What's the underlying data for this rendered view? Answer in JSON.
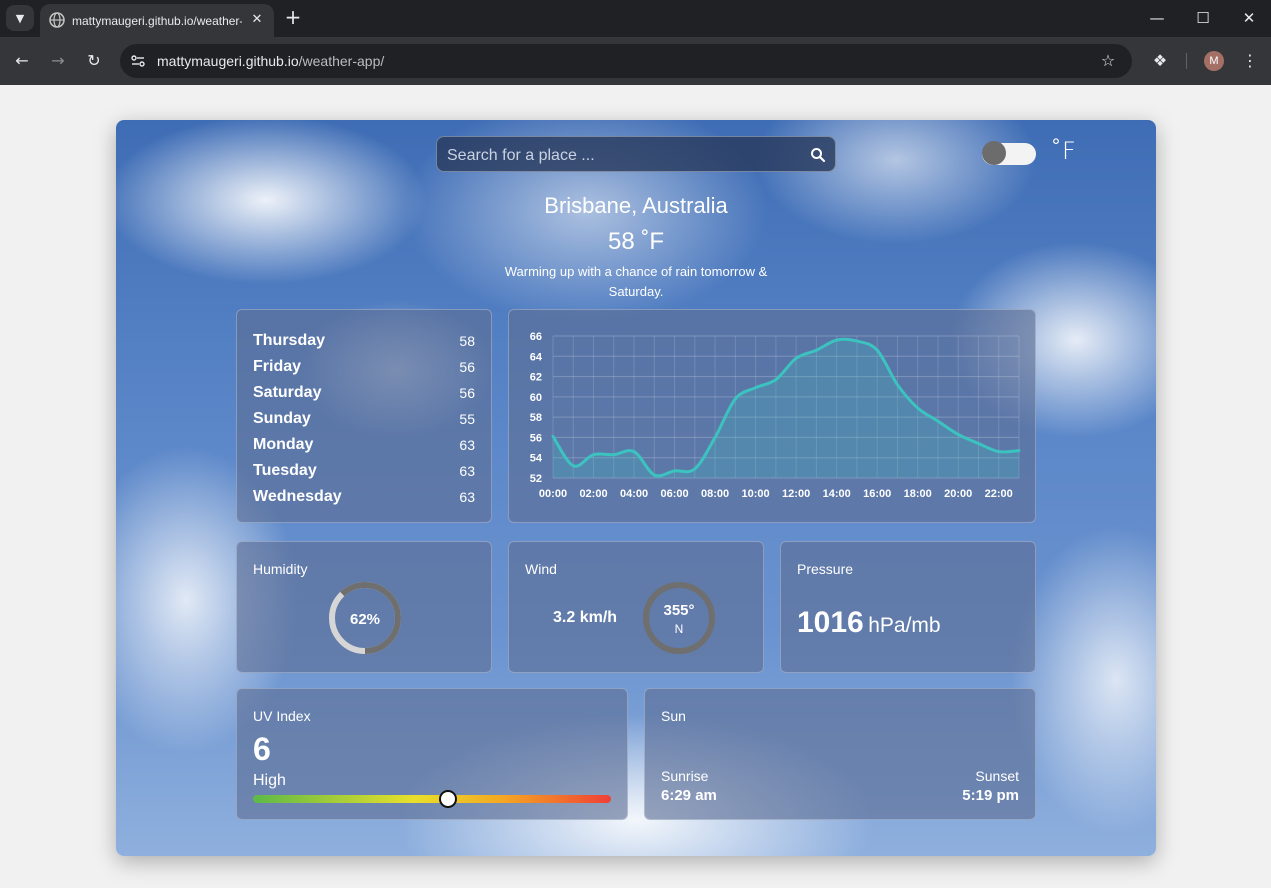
{
  "browser": {
    "tab_title": "mattymaugeri.github.io/weather-app/",
    "url_host": "mattymaugeri.github.io",
    "url_path": "/weather-app/",
    "profile_initial": "M"
  },
  "app": {
    "search": {
      "placeholder": "Search for a place ..."
    },
    "unit_toggle": {
      "label": "˚F",
      "state": "fahrenheit"
    },
    "location": "Brisbane, Australia",
    "current_temp": "58 ˚F",
    "summary": "Warming up with a chance of rain tomorrow & Saturday.",
    "forecast": [
      {
        "day": "Thursday",
        "value": "58"
      },
      {
        "day": "Friday",
        "value": "56"
      },
      {
        "day": "Saturday",
        "value": "56"
      },
      {
        "day": "Sunday",
        "value": "55"
      },
      {
        "day": "Monday",
        "value": "63"
      },
      {
        "day": "Tuesday",
        "value": "63"
      },
      {
        "day": "Wednesday",
        "value": "63"
      }
    ],
    "humidity": {
      "label": "Humidity",
      "value": "62%",
      "fraction": 0.62
    },
    "wind": {
      "label": "Wind",
      "speed": "3.2 km/h",
      "degrees": "355°",
      "direction": "N"
    },
    "pressure": {
      "label": "Pressure",
      "value": "1016",
      "unit": "hPa/mb"
    },
    "uv": {
      "label": "UV Index",
      "value": "6",
      "level": "High",
      "position_fraction": 0.545
    },
    "sun": {
      "label": "Sun",
      "sunrise_label": "Sunrise",
      "sunrise": "6:29 am",
      "sunset_label": "Sunset",
      "sunset": "5:19 pm"
    }
  },
  "colors": {
    "accent": "#3cc3c0",
    "card": "#5c6e94"
  },
  "chart_data": {
    "type": "area",
    "x": [
      "00:00",
      "01:00",
      "02:00",
      "03:00",
      "04:00",
      "05:00",
      "06:00",
      "07:00",
      "08:00",
      "09:00",
      "10:00",
      "11:00",
      "12:00",
      "13:00",
      "14:00",
      "15:00",
      "16:00",
      "17:00",
      "18:00",
      "19:00",
      "20:00",
      "21:00",
      "22:00",
      "23:00"
    ],
    "x_tick_labels": [
      "00:00",
      "02:00",
      "04:00",
      "06:00",
      "08:00",
      "10:00",
      "12:00",
      "14:00",
      "16:00",
      "18:00",
      "20:00",
      "22:00"
    ],
    "series": [
      {
        "values": [
          56.1,
          53.2,
          54.3,
          54.3,
          54.6,
          52.3,
          52.7,
          52.9,
          56.0,
          59.8,
          60.9,
          61.7,
          63.8,
          64.6,
          65.6,
          65.5,
          64.6,
          61.2,
          58.9,
          57.6,
          56.3,
          55.4,
          54.6,
          54.7
        ]
      }
    ],
    "ylim": [
      52,
      66
    ],
    "y_ticks": [
      52,
      54,
      56,
      58,
      60,
      62,
      64,
      66
    ],
    "grid": true
  }
}
